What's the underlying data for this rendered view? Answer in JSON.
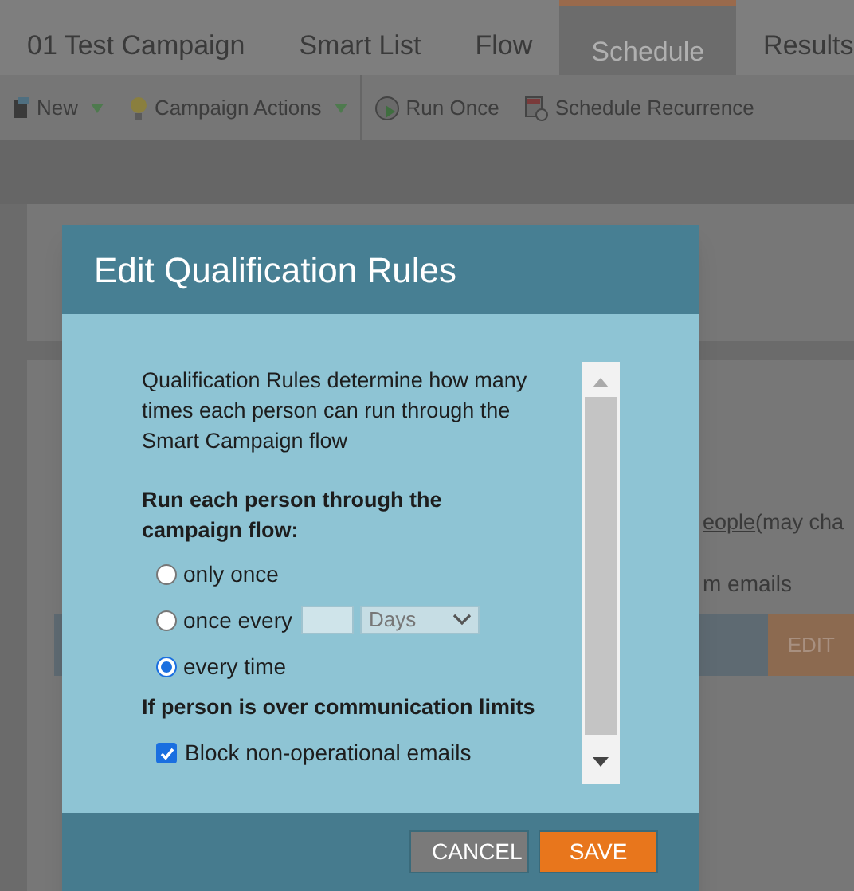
{
  "tabs": [
    {
      "label": "01 Test Campaign",
      "selected": false
    },
    {
      "label": "Smart List",
      "selected": false
    },
    {
      "label": "Flow",
      "selected": false
    },
    {
      "label": "Schedule",
      "selected": true
    },
    {
      "label": "Results",
      "selected": false
    }
  ],
  "toolbar": [
    {
      "label": "New",
      "kind": "new",
      "menu": true
    },
    {
      "label": "Campaign Actions",
      "kind": "bulb",
      "menu": true
    },
    {
      "label": "Run Once",
      "kind": "run",
      "menu": false
    },
    {
      "label": "Schedule Recurrence",
      "kind": "calendar",
      "menu": false
    }
  ],
  "background": {
    "link": "eople ",
    "link_after": "(may cha",
    "line": "m emails",
    "edit_button": "EDIT"
  },
  "dialog": {
    "title": "Edit Qualification Rules",
    "intro": "Qualification Rules determine how many times each person can run through the Smart Campaign flow",
    "run_heading": "Run each person through the campaign flow:",
    "options": [
      {
        "label": "only once",
        "selected": false
      },
      {
        "label": "once every",
        "selected": false,
        "unit": "Days"
      },
      {
        "label": "every time",
        "selected": true
      }
    ],
    "limits_heading": "If person is over communication limits",
    "block": {
      "label": "Block non-operational emails",
      "checked": true
    },
    "buttons": [
      {
        "label": "CANCEL",
        "kind": "secondary"
      },
      {
        "label": "SAVE",
        "kind": "primary"
      }
    ]
  }
}
